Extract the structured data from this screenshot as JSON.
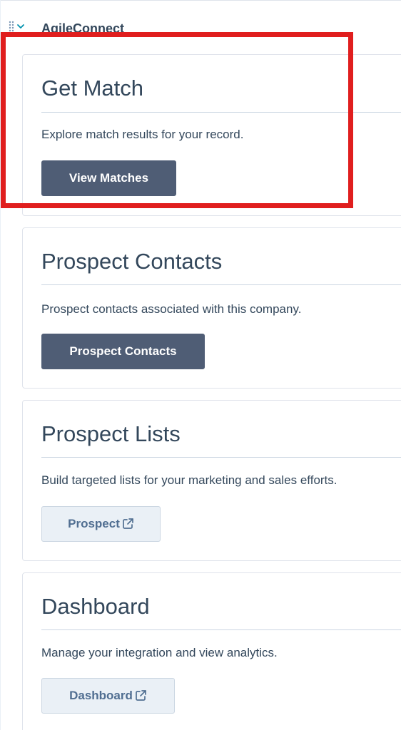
{
  "section": {
    "title": "AgileConnect"
  },
  "cards": [
    {
      "title": "Get Match",
      "description": "Explore match results for your record.",
      "button_label": "View Matches"
    },
    {
      "title": "Prospect Contacts",
      "description": "Prospect contacts associated with this company.",
      "button_label": "Prospect Contacts"
    },
    {
      "title": "Prospect Lists",
      "description": "Build targeted lists for your marketing and sales efforts.",
      "button_label": "Prospect"
    },
    {
      "title": "Dashboard",
      "description": "Manage your integration and view analytics.",
      "button_label": "Dashboard"
    }
  ],
  "icons": {
    "drag": "drag-handle-icon",
    "chevron": "chevron-down-icon",
    "external": "external-link-icon"
  },
  "colors": {
    "highlight": "#e01e1e",
    "primary_button": "#4f5d75",
    "secondary_button": "#eaf0f6",
    "text": "#33475b"
  }
}
